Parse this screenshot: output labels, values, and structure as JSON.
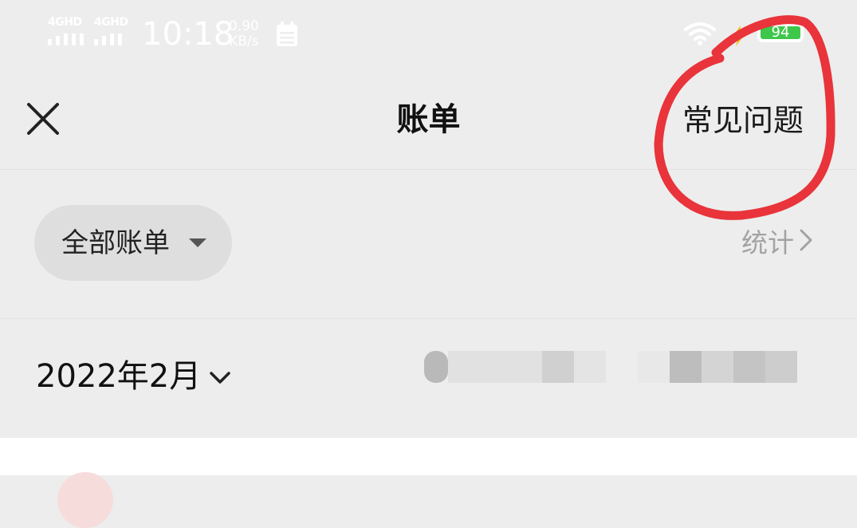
{
  "status_bar": {
    "signal_1": "4GHD",
    "signal_2": "4GHD",
    "time": "10:18",
    "speed_value": "0.90",
    "speed_unit": "KB/s",
    "battery": "94",
    "icons": [
      "signal-icon",
      "calendar-icon",
      "wifi-icon",
      "charging-icon",
      "battery-icon"
    ]
  },
  "nav": {
    "close_icon": "close-icon",
    "title": "账单",
    "faq": "常见问题"
  },
  "filter": {
    "label": "全部账单",
    "caret_icon": "caret-down-icon",
    "stats": "统计"
  },
  "month": {
    "label": "2022年2月",
    "chevron_icon": "chevron-down-icon"
  },
  "colors": {
    "background": "#ededed",
    "pill": "#dedede",
    "muted_text": "#a3a3a3",
    "annotation_red": "#e8343a",
    "battery_green": "#3ec74a"
  }
}
